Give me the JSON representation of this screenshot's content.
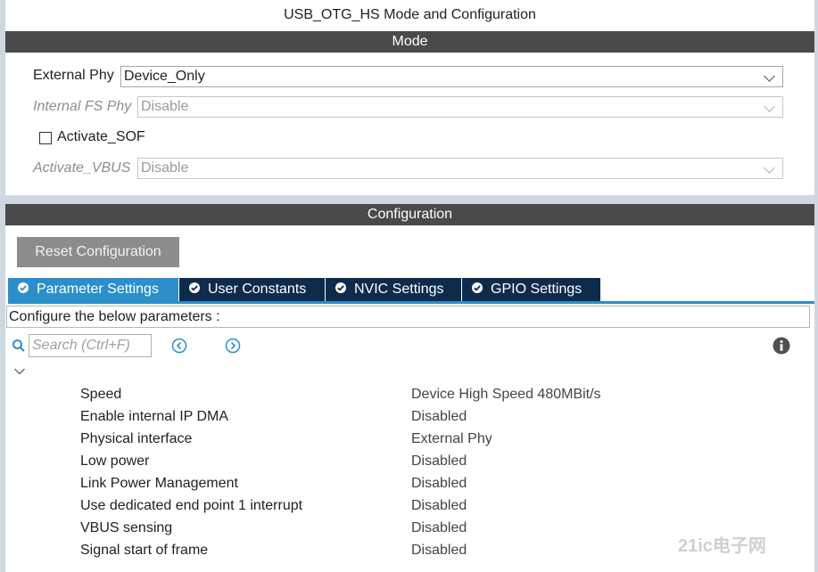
{
  "window": {
    "title": "USB_OTG_HS Mode and Configuration"
  },
  "mode": {
    "header": "Mode",
    "external_phy": {
      "label": "External Phy",
      "value": "Device_Only"
    },
    "internal_fs_phy": {
      "label": "Internal FS Phy",
      "value": "Disable"
    },
    "activate_sof": {
      "label": "Activate_SOF",
      "checked": false
    },
    "activate_vbus": {
      "label": "Activate_VBUS",
      "value": "Disable"
    }
  },
  "configuration": {
    "header": "Configuration",
    "reset_label": "Reset Configuration",
    "tabs": [
      {
        "label": "Parameter Settings",
        "active": true
      },
      {
        "label": "User Constants",
        "active": false
      },
      {
        "label": "NVIC Settings",
        "active": false
      },
      {
        "label": "GPIO Settings",
        "active": false
      }
    ],
    "instructions": "Configure the below parameters :",
    "search_placeholder": "Search (Ctrl+F)",
    "parameters": [
      {
        "name": "Speed",
        "value": "Device High Speed 480MBit/s"
      },
      {
        "name": "Enable internal IP DMA",
        "value": "Disabled"
      },
      {
        "name": "Physical interface",
        "value": "External Phy"
      },
      {
        "name": "Low power",
        "value": "Disabled"
      },
      {
        "name": "Link Power Management",
        "value": "Disabled"
      },
      {
        "name": "Use dedicated end point 1 interrupt",
        "value": "Disabled"
      },
      {
        "name": "VBUS sensing",
        "value": "Disabled"
      },
      {
        "name": "Signal start of frame",
        "value": "Disabled"
      }
    ]
  },
  "watermark": "21ic电子网",
  "colors": {
    "band": "#4a4a4a",
    "tab_active": "#2c8fc9",
    "tab_inactive": "#0e2b4c",
    "reset_button": "#8c8c8c",
    "frame": "#cfd7e2"
  },
  "icons": [
    "search-icon",
    "prev-arrow-icon",
    "next-arrow-icon",
    "info-icon",
    "collapse-chevron-icon",
    "check-circle-icon"
  ]
}
